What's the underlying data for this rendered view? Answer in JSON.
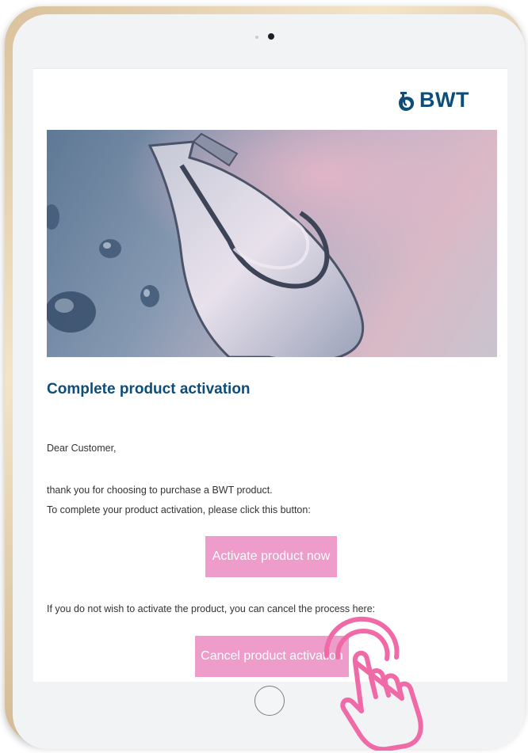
{
  "brand": {
    "name": "BWT",
    "color": "#0d4d7a",
    "logo_icon": "bwt-drop-logo-icon"
  },
  "email": {
    "heading": "Complete product activation",
    "greeting": "Dear Customer,",
    "line1": "thank you for choosing to purchase a BWT product.",
    "line2": "To complete your product activation, please click this button:",
    "activate_button": "Activate product now",
    "cancel_text": "If you do not wish to activate the product, you can cancel the process here:",
    "cancel_button": "Cancel product activation"
  },
  "colors": {
    "button": "#ee9dcb",
    "hand_icon": "#f06aa8",
    "frame": "#d9c19c"
  },
  "icons": {
    "camera": "camera-icon",
    "home": "home-button-icon",
    "hand": "tap-hand-icon"
  }
}
